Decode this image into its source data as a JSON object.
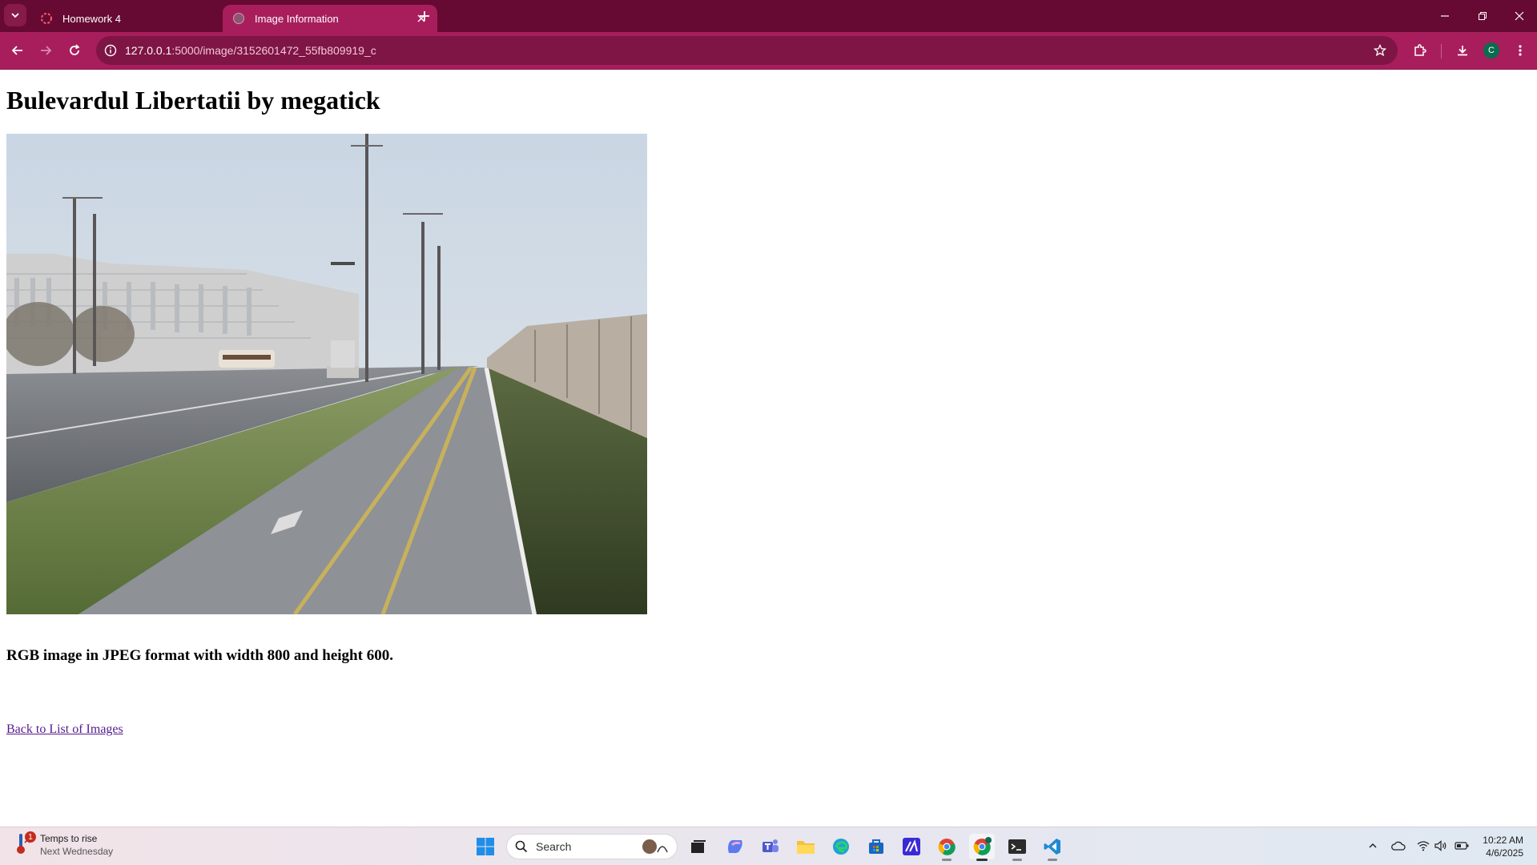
{
  "browser": {
    "tabs": [
      {
        "title": "Homework 4",
        "active": false
      },
      {
        "title": "Image Information",
        "active": true
      }
    ],
    "url": {
      "host": "127.0.0.1",
      "rest": ":5000/image/3152601472_55fb809919_c"
    },
    "profile_initial": "C"
  },
  "page": {
    "heading": "Bulevardul Libertatii by megatick",
    "image_alt": "Bulevardul Libertatii by megatick",
    "info": "RGB image in JPEG format with width 800 and height 600.",
    "back_link": "Back to List of Images"
  },
  "taskbar": {
    "weather": {
      "line1": "Temps to rise",
      "line2": "Next Wednesday",
      "badge": "1"
    },
    "search_placeholder": "Search",
    "clock": {
      "time": "10:22 AM",
      "date": "4/6/2025"
    }
  },
  "colors": {
    "tabbar": "#660a33",
    "toolbar": "#a81e5c",
    "link_visited": "#551a8b"
  }
}
